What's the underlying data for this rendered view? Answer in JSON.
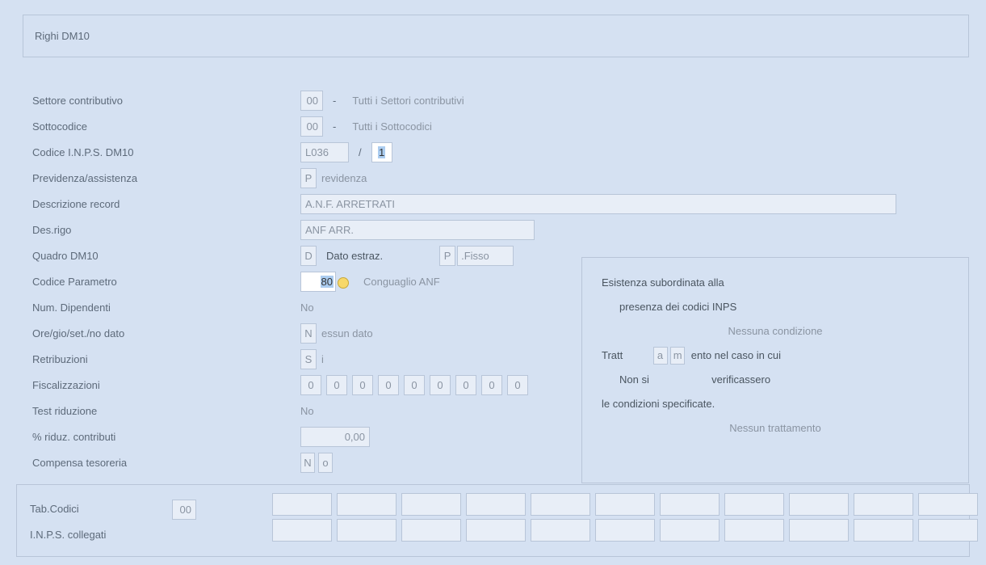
{
  "panel_title": "Righi DM10",
  "settore": {
    "label": "Settore contributivo",
    "value": "00",
    "desc": "Tutti i Settori contributivi"
  },
  "sotto": {
    "label": "Sottocodice",
    "value": "00",
    "desc": "Tutti i Sottocodici"
  },
  "inps": {
    "label": "Codice I.N.P.S. DM10",
    "value": "L036",
    "sep": "/",
    "suffix": "1"
  },
  "prev": {
    "label": "Previdenza/assistenza",
    "prefix": "P",
    "desc": "revidenza"
  },
  "descrec": {
    "label": "Descrizione record",
    "value": "A.N.F. ARRETRATI"
  },
  "desrigo": {
    "label": "Des.rigo",
    "value": "ANF ARR."
  },
  "quadro": {
    "label": "Quadro DM10",
    "prefix": "D",
    "mid": "Dato estraz.",
    "p": "P",
    "dot": ".",
    "fisso": "Fisso"
  },
  "param": {
    "label": "Codice Parametro",
    "value": "80",
    "desc": "Conguaglio ANF"
  },
  "numdip": {
    "label": "Num. Dipendenti",
    "value": "No"
  },
  "ore": {
    "label": "Ore/gio/set./no dato",
    "prefix": "N",
    "desc": "essun dato"
  },
  "retrib": {
    "label": "Retribuzioni",
    "prefix": "S",
    "desc": "i"
  },
  "fisc": {
    "label": "Fiscalizzazioni",
    "values": [
      "0",
      "0",
      "0",
      "0",
      "0",
      "0",
      "0",
      "0",
      "0"
    ]
  },
  "testrid": {
    "label": "Test riduzione",
    "value": "No"
  },
  "pctrid": {
    "label": "% riduz. contributi",
    "value": "0,00"
  },
  "compensa": {
    "label": "Compensa tesoreria",
    "prefix": "N",
    "suffix": "o"
  },
  "side": {
    "l1": "Esistenza subordinata alla",
    "l2": "presenza dei codici INPS",
    "l3": "Nessuna condizione",
    "l4a": "Tratt",
    "l4b": "a",
    "l4c": "m",
    "l4d": "ento nel caso in cui",
    "l5a": "Non si",
    "l5b": "verificassero",
    "l6": "le condizioni specificate.",
    "l7": "Nessun trattamento"
  },
  "bottom": {
    "tab_label": "Tab.Codici",
    "tab_value": "00",
    "inps_label": "I.N.P.S. collegati"
  }
}
